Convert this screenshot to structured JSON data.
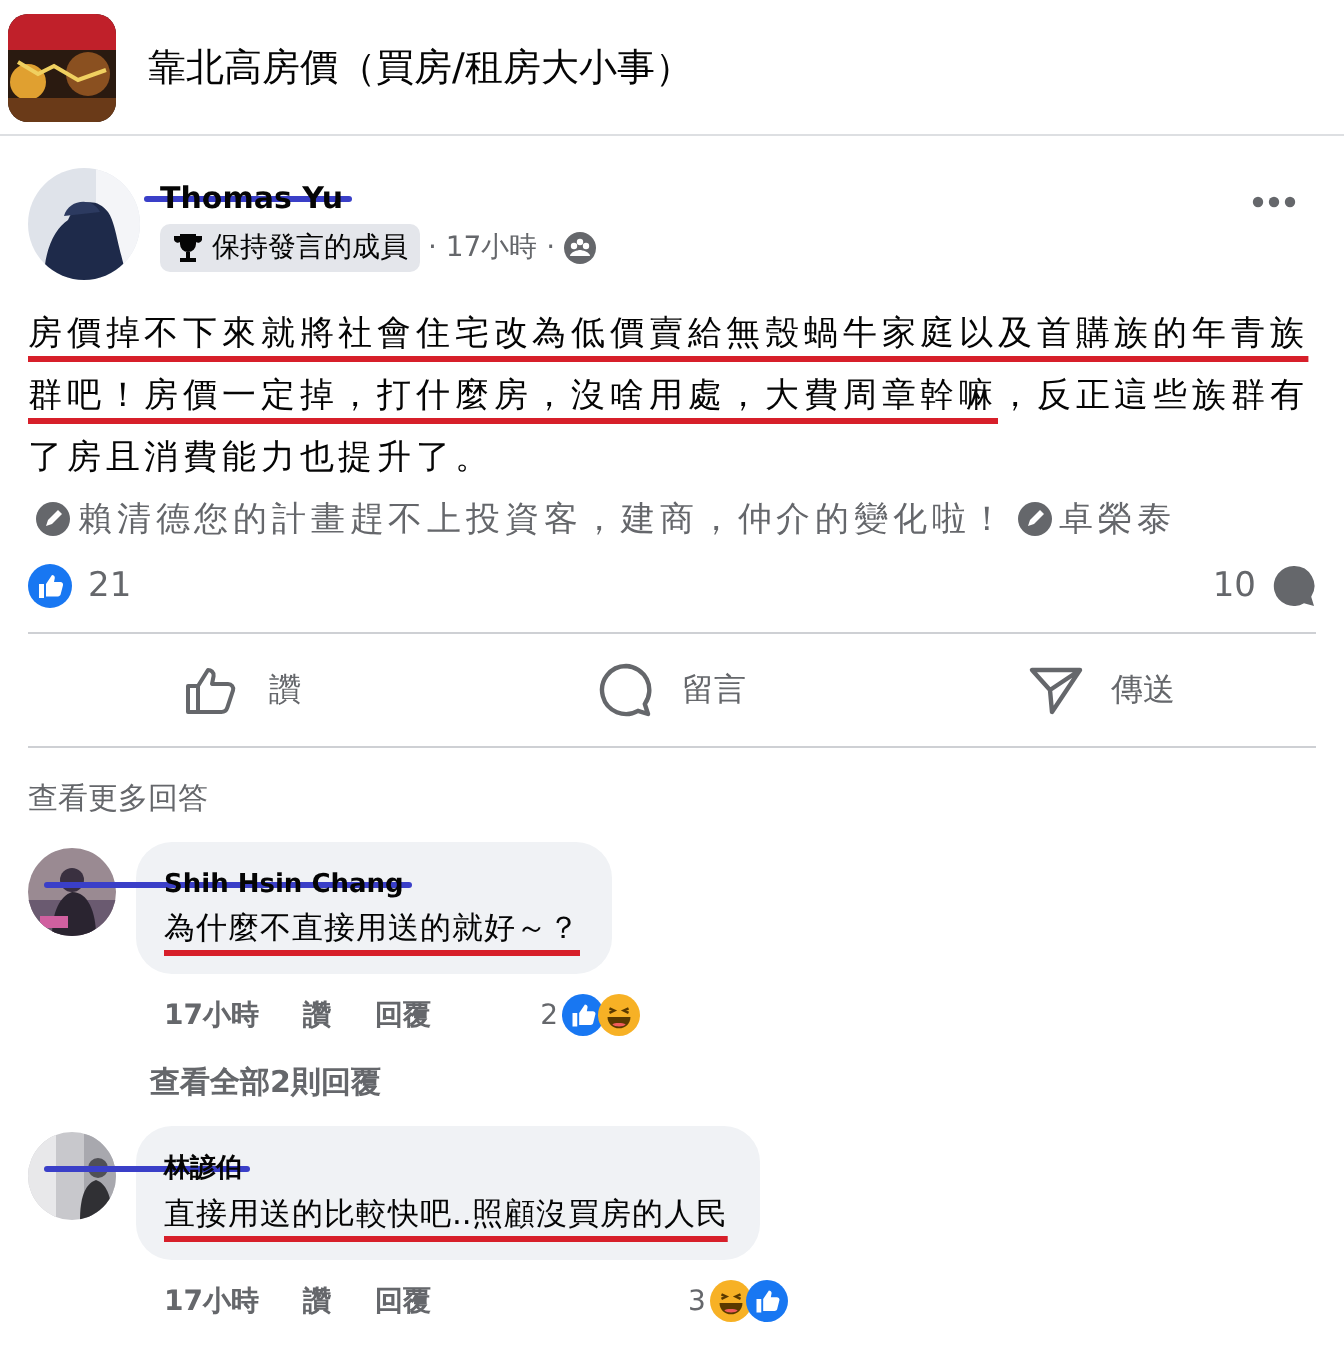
{
  "group": {
    "title": "靠北高房價（買房/租房大小事）"
  },
  "post": {
    "author": "Thomas Yu",
    "author_struck_out": true,
    "badge": "保持發言的成員",
    "time": "· 17小時 ·",
    "body": [
      {
        "kind": "text",
        "text": "房價掉不下來就將社會住宅改為低價賣給無殼蝸牛家庭以及首購族的年青族群吧！房價一定掉，打什麼房，沒啥用處，大費周章幹嘛",
        "underlined": true
      },
      {
        "kind": "text",
        "text": "，反正這些族群有了房且消費能力也提升了。",
        "underlined": false
      },
      {
        "kind": "mention",
        "text": "賴清德您的計畫趕不上投資客，建商，仲介的變化啦！"
      },
      {
        "kind": "mention",
        "text": "卓榮泰"
      }
    ],
    "like_count": "21",
    "comment_count": "10",
    "actions": [
      {
        "kind": "like",
        "label": "讚"
      },
      {
        "kind": "comment",
        "label": "留言"
      },
      {
        "kind": "share",
        "label": "傳送"
      }
    ]
  },
  "more_replies": "查看更多回答",
  "comments": [
    {
      "author": "Shih Hsin Chang",
      "author_struck_out": true,
      "text": "為什麼不直接用送的就好～？",
      "underlined": true,
      "time": "17小時",
      "like": "讚",
      "reply": "回覆",
      "reaction_count": "2",
      "reactions": [
        {
          "kind": "like"
        },
        {
          "kind": "haha"
        }
      ],
      "replies_link": "查看全部2則回覆"
    },
    {
      "author": "林諺伯",
      "author_struck_out": true,
      "text": "直接用送的比較快吧..照顧沒買房的人民",
      "underlined": true,
      "time": "17小時",
      "like": "讚",
      "reply": "回覆",
      "reaction_count": "3",
      "reactions": [
        {
          "kind": "haha"
        },
        {
          "kind": "like"
        }
      ]
    }
  ]
}
